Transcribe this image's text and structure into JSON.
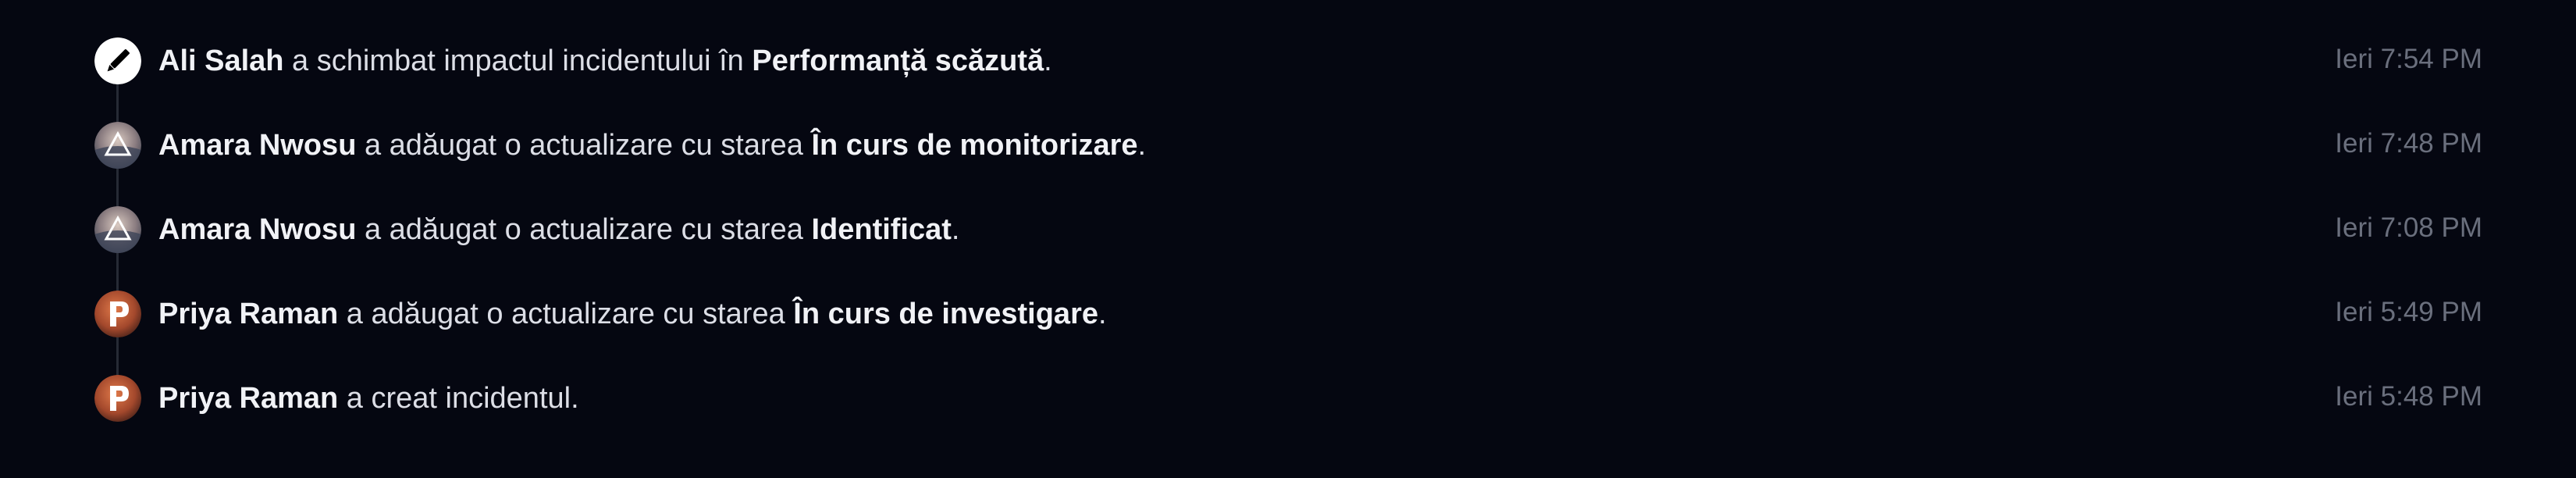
{
  "events": [
    {
      "avatar_icon": "pencil-icon",
      "actor": "Ali Salah",
      "action": " a schimbat impactul incidentului în ",
      "detail": "Performanță scăzută",
      "suffix": ".",
      "time": "Ieri 7:54 PM"
    },
    {
      "avatar_icon": "triangle-icon",
      "actor": "Amara Nwosu",
      "action": " a adăugat o actualizare cu starea ",
      "detail": "În curs de monitorizare",
      "suffix": ".",
      "time": "Ieri 7:48 PM"
    },
    {
      "avatar_icon": "triangle-icon",
      "actor": "Amara Nwosu",
      "action": " a adăugat o actualizare cu starea ",
      "detail": "Identificat",
      "suffix": ".",
      "time": "Ieri 7:08 PM"
    },
    {
      "avatar_icon": "p-logo-icon",
      "actor": "Priya Raman",
      "action": " a adăugat o actualizare cu starea ",
      "detail": "În curs de investigare",
      "suffix": ".",
      "time": "Ieri 5:49 PM"
    },
    {
      "avatar_icon": "p-logo-icon",
      "actor": "Priya Raman",
      "action": " a creat incidentul.",
      "detail": "",
      "suffix": "",
      "time": "Ieri 5:48 PM"
    }
  ],
  "colors": {
    "background": "#050711",
    "text": "#dcdee6",
    "timestamp": "#6a6f7d",
    "timeline_line": "#262a35"
  }
}
